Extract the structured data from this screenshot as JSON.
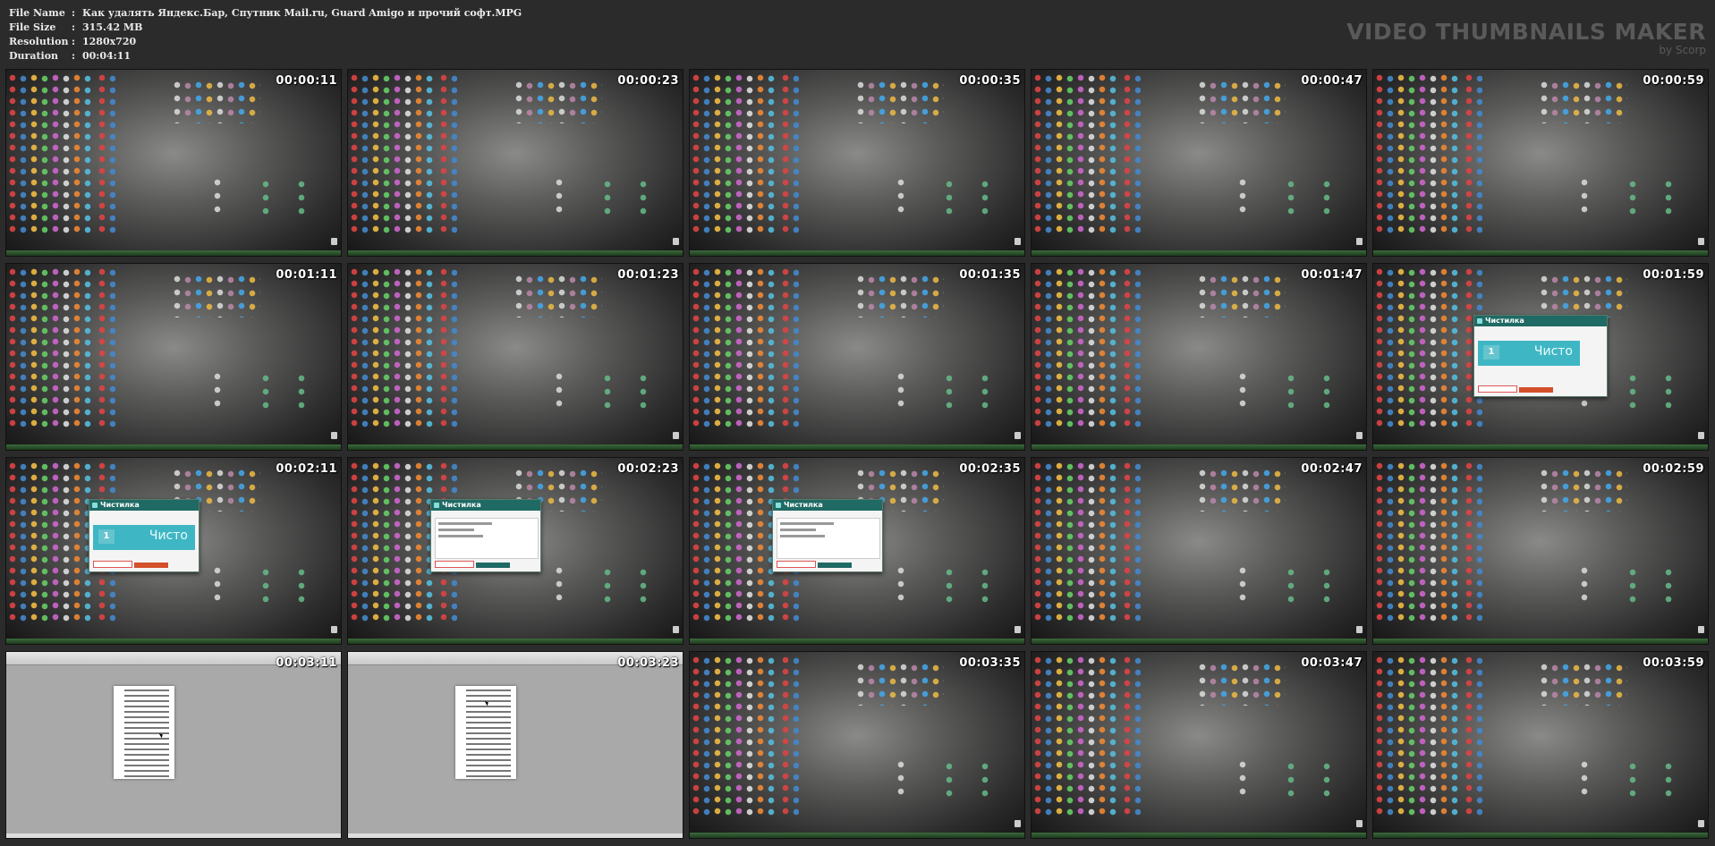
{
  "header": {
    "rows": [
      {
        "label": "File Name",
        "sep": ":",
        "value": "Как удалять Яндекс.Бар, Спутник Mail.ru, Guard Amigo и прочий софт.MPG"
      },
      {
        "label": "File Size",
        "sep": ":",
        "value": "315.42 MB"
      },
      {
        "label": "Resolution",
        "sep": ":",
        "value": "1280x720"
      },
      {
        "label": "Duration",
        "sep": ":",
        "value": "00:04:11"
      }
    ],
    "brand_title": "VIDEO THUMBNAILS MAKER",
    "brand_sub": "by Scorp"
  },
  "thumbnails": [
    {
      "time": "00:00:11",
      "scene": "desktop"
    },
    {
      "time": "00:00:23",
      "scene": "desktop"
    },
    {
      "time": "00:00:35",
      "scene": "desktop"
    },
    {
      "time": "00:00:47",
      "scene": "desktop"
    },
    {
      "time": "00:00:59",
      "scene": "desktop"
    },
    {
      "time": "00:01:11",
      "scene": "desktop"
    },
    {
      "time": "00:01:23",
      "scene": "desktop"
    },
    {
      "time": "00:01:35",
      "scene": "desktop"
    },
    {
      "time": "00:01:47",
      "scene": "desktop"
    },
    {
      "time": "00:01:59",
      "scene": "dialog"
    },
    {
      "time": "00:02:11",
      "scene": "dialog"
    },
    {
      "time": "00:02:23",
      "scene": "dialog-list"
    },
    {
      "time": "00:02:35",
      "scene": "dialog-list"
    },
    {
      "time": "00:02:47",
      "scene": "desktop"
    },
    {
      "time": "00:02:59",
      "scene": "desktop"
    },
    {
      "time": "00:03:11",
      "scene": "document"
    },
    {
      "time": "00:03:23",
      "scene": "document"
    },
    {
      "time": "00:03:35",
      "scene": "desktop"
    },
    {
      "time": "00:03:47",
      "scene": "desktop"
    },
    {
      "time": "00:03:59",
      "scene": "desktop"
    }
  ],
  "dialog": {
    "title": "Чистилка",
    "count": "1",
    "panel_text": "Чисто"
  },
  "colors": {
    "background": "#2b2b2b",
    "dialog_header": "#1f6a64",
    "dialog_panel": "#3fb6c4",
    "dialog_button": "#d3502b"
  }
}
